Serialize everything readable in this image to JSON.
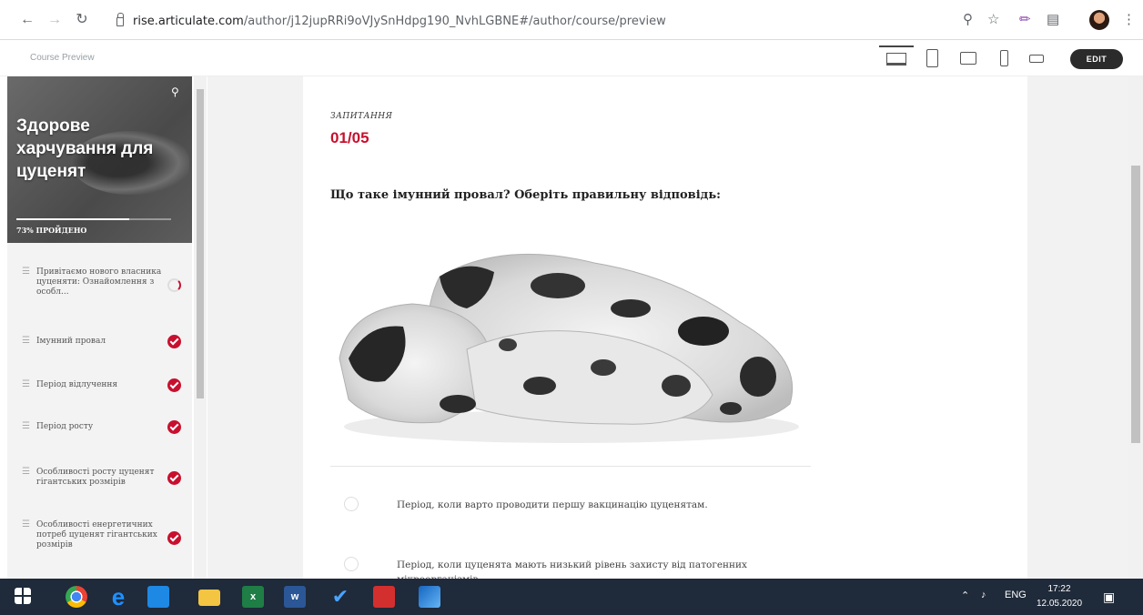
{
  "browser": {
    "url_host": "rise.articulate.com",
    "url_path": "/author/j12jupRRi9oVJySnHdpg190_NvhLGBNE#/author/course/preview"
  },
  "preview": {
    "label": "Course Preview",
    "edit_label": "EDIT"
  },
  "sidebar": {
    "title": "Здорове харчування для цуценят",
    "progress_label": "73% ПРОЙДЕНО",
    "progress_fraction": 0.73,
    "lessons": [
      {
        "label": "Привітаємо нового власника цуценяти: Ознайомлення з особл...",
        "status": "in-progress"
      },
      {
        "label": "Імунний провал",
        "status": "complete"
      },
      {
        "label": "Період відлучення",
        "status": "complete"
      },
      {
        "label": "Період росту",
        "status": "complete"
      },
      {
        "label": "Особливості росту цуценят гігантських розмірів",
        "status": "complete"
      },
      {
        "label": "Особливості енергетичних потреб цуценят гігантських розмірів",
        "status": "complete"
      }
    ]
  },
  "question": {
    "kicker": "ЗАПИТАННЯ",
    "counter": "01/05",
    "text": "Що таке імунний провал? Оберіть правильну відповідь:",
    "answers": [
      "Період, коли варто проводити першу вакцинацію цуценятам.",
      "Період, коли цуценята мають низький рівень захисту від патогенних мікроорганізмів"
    ]
  },
  "taskbar": {
    "lang": "ENG",
    "time": "17:22",
    "date": "12.05.2020"
  },
  "colors": {
    "accent": "#c8102e",
    "taskbar": "#1f2a3a",
    "sidebar_header": "#5a5a5a"
  }
}
